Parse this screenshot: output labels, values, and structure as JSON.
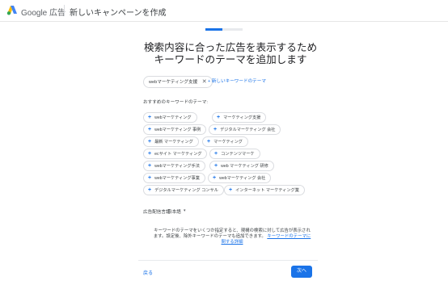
{
  "header": {
    "brand": "Google 広告",
    "title": "新しいキャンペーンを作成"
  },
  "progress": {
    "value_percent": 45
  },
  "main": {
    "heading": "検索内容に合った広告を表示するためキーワードのテーマを追加します",
    "selected_keyword": "webマーケティング支援",
    "new_theme_link": "+ 新しいキーワードのテーマ",
    "suggestions_label": "おすすめのキーワードのテーマ:",
    "suggestions": [
      "webマーケティング",
      "マーケティング支援",
      "webマーケティング 事例",
      "デジタルマーケティング 会社",
      "最新 マーケティング",
      "マーケティング",
      "ecサイト マーケティング",
      "コンテンツマーケ",
      "webマーケティング手法",
      "web マーケティング 研修",
      "webマーケティング事業",
      "webマーケティング 会社",
      "デジタルマーケティング コンサル",
      "インターネット マーケティング業"
    ],
    "language_label": "広告配信言語:",
    "language_value": "日本語",
    "help_text": "キーワードのテーマをいくつか指定すると、現構の検索に対して広告が表示されます。設定後、除外キーワードのテーマも追加できます。",
    "help_link": "キーワードのテーマに関する詳細"
  },
  "footer": {
    "back": "戻る",
    "next": "次へ"
  },
  "colors": {
    "accent": "#1a73e8",
    "border": "#dadce0"
  }
}
